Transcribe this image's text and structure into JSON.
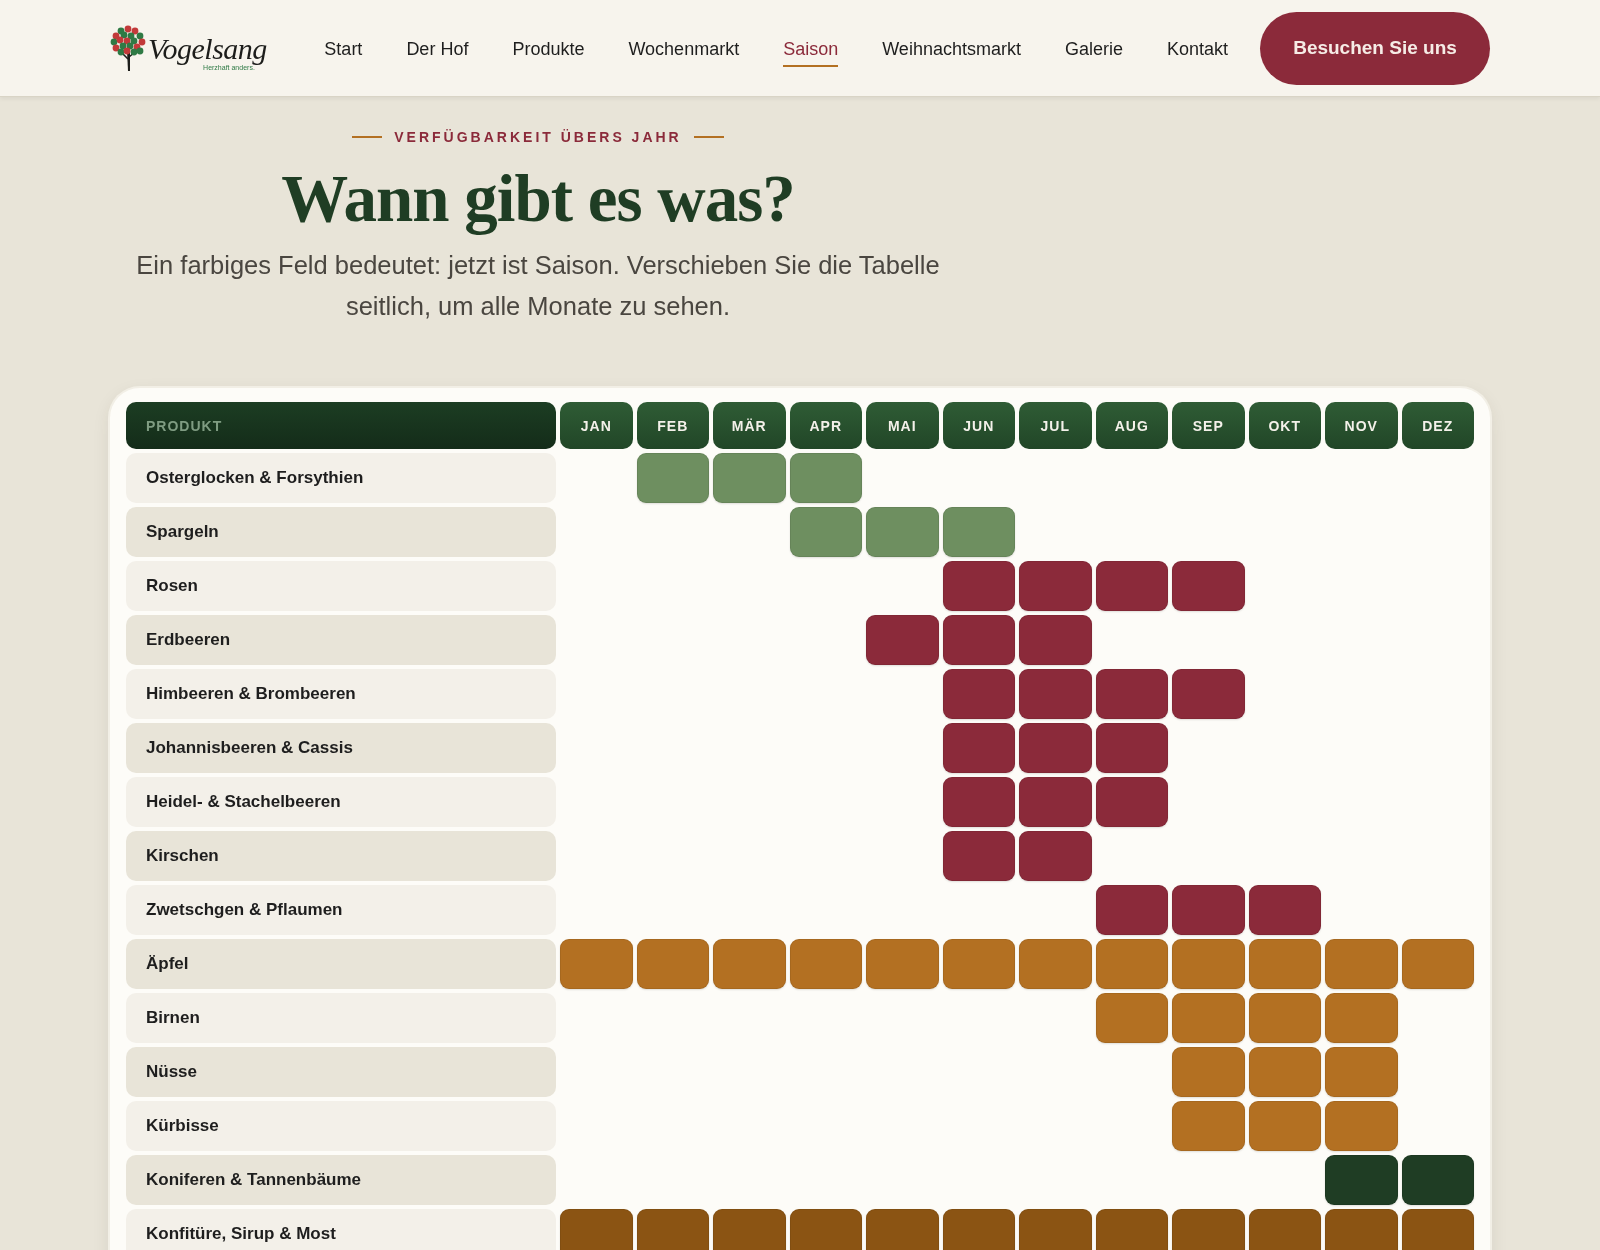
{
  "header": {
    "logo": {
      "name": "Vogelsang",
      "tagline": "Herzhaft anders."
    },
    "nav": [
      {
        "label": "Start",
        "selected": false
      },
      {
        "label": "Der Hof",
        "selected": false
      },
      {
        "label": "Produkte",
        "selected": false
      },
      {
        "label": "Wochenmarkt",
        "selected": false
      },
      {
        "label": "Saison",
        "selected": true
      },
      {
        "label": "Weihnachtsmarkt",
        "selected": false
      },
      {
        "label": "Galerie",
        "selected": false
      },
      {
        "label": "Kontakt",
        "selected": false
      }
    ],
    "cta": "Besuchen Sie uns"
  },
  "intro": {
    "eyebrow": "VERFÜGBARKEIT ÜBERS JAHR",
    "title": "Wann gibt es was?",
    "text": "Ein farbiges Feld bedeutet: jetzt ist Saison. Verschieben Sie die Tabelle seitlich, um alle Monate zu sehen."
  },
  "table": {
    "columns": [
      "PRODUKT",
      "JAN",
      "FEB",
      "MÄR",
      "APR",
      "MAI",
      "JUN",
      "JUL",
      "AUG",
      "SEP",
      "OKT",
      "NOV",
      "DEZ"
    ],
    "rows": [
      {
        "name": "Osterglocken & Forsythien",
        "color": "#6e8f60",
        "season": [
          false,
          true,
          true,
          true,
          false,
          false,
          false,
          false,
          false,
          false,
          false,
          false
        ]
      },
      {
        "name": "Spargeln",
        "color": "#6e8f60",
        "season": [
          false,
          false,
          false,
          true,
          true,
          true,
          false,
          false,
          false,
          false,
          false,
          false
        ]
      },
      {
        "name": "Rosen",
        "color": "#8b2a3a",
        "season": [
          false,
          false,
          false,
          false,
          false,
          true,
          true,
          true,
          true,
          false,
          false,
          false
        ]
      },
      {
        "name": "Erdbeeren",
        "color": "#8b2a3a",
        "season": [
          false,
          false,
          false,
          false,
          true,
          true,
          true,
          false,
          false,
          false,
          false,
          false
        ]
      },
      {
        "name": "Himbeeren & Brombeeren",
        "color": "#8b2a3a",
        "season": [
          false,
          false,
          false,
          false,
          false,
          true,
          true,
          true,
          true,
          false,
          false,
          false
        ]
      },
      {
        "name": "Johannisbeeren & Cassis",
        "color": "#8b2a3a",
        "season": [
          false,
          false,
          false,
          false,
          false,
          true,
          true,
          true,
          false,
          false,
          false,
          false
        ]
      },
      {
        "name": "Heidel- & Stachelbeeren",
        "color": "#8b2a3a",
        "season": [
          false,
          false,
          false,
          false,
          false,
          true,
          true,
          true,
          false,
          false,
          false,
          false
        ]
      },
      {
        "name": "Kirschen",
        "color": "#8b2a3a",
        "season": [
          false,
          false,
          false,
          false,
          false,
          true,
          true,
          false,
          false,
          false,
          false,
          false
        ]
      },
      {
        "name": "Zwetschgen & Pflaumen",
        "color": "#8b2a3a",
        "season": [
          false,
          false,
          false,
          false,
          false,
          false,
          false,
          true,
          true,
          true,
          false,
          false
        ]
      },
      {
        "name": "Äpfel",
        "color": "#b37022",
        "season": [
          true,
          true,
          true,
          true,
          true,
          true,
          true,
          true,
          true,
          true,
          true,
          true
        ]
      },
      {
        "name": "Birnen",
        "color": "#b37022",
        "season": [
          false,
          false,
          false,
          false,
          false,
          false,
          false,
          true,
          true,
          true,
          true,
          false
        ]
      },
      {
        "name": "Nüsse",
        "color": "#b37022",
        "season": [
          false,
          false,
          false,
          false,
          false,
          false,
          false,
          false,
          true,
          true,
          true,
          false
        ]
      },
      {
        "name": "Kürbisse",
        "color": "#b37022",
        "season": [
          false,
          false,
          false,
          false,
          false,
          false,
          false,
          false,
          true,
          true,
          true,
          false
        ]
      },
      {
        "name": "Koniferen & Tannenbäume",
        "color": "#1f3d24",
        "season": [
          false,
          false,
          false,
          false,
          false,
          false,
          false,
          false,
          false,
          false,
          true,
          true
        ]
      },
      {
        "name": "Konfitüre, Sirup & Most",
        "color": "#8b5413",
        "season": [
          true,
          true,
          true,
          true,
          true,
          true,
          true,
          true,
          true,
          true,
          true,
          true
        ]
      }
    ]
  }
}
